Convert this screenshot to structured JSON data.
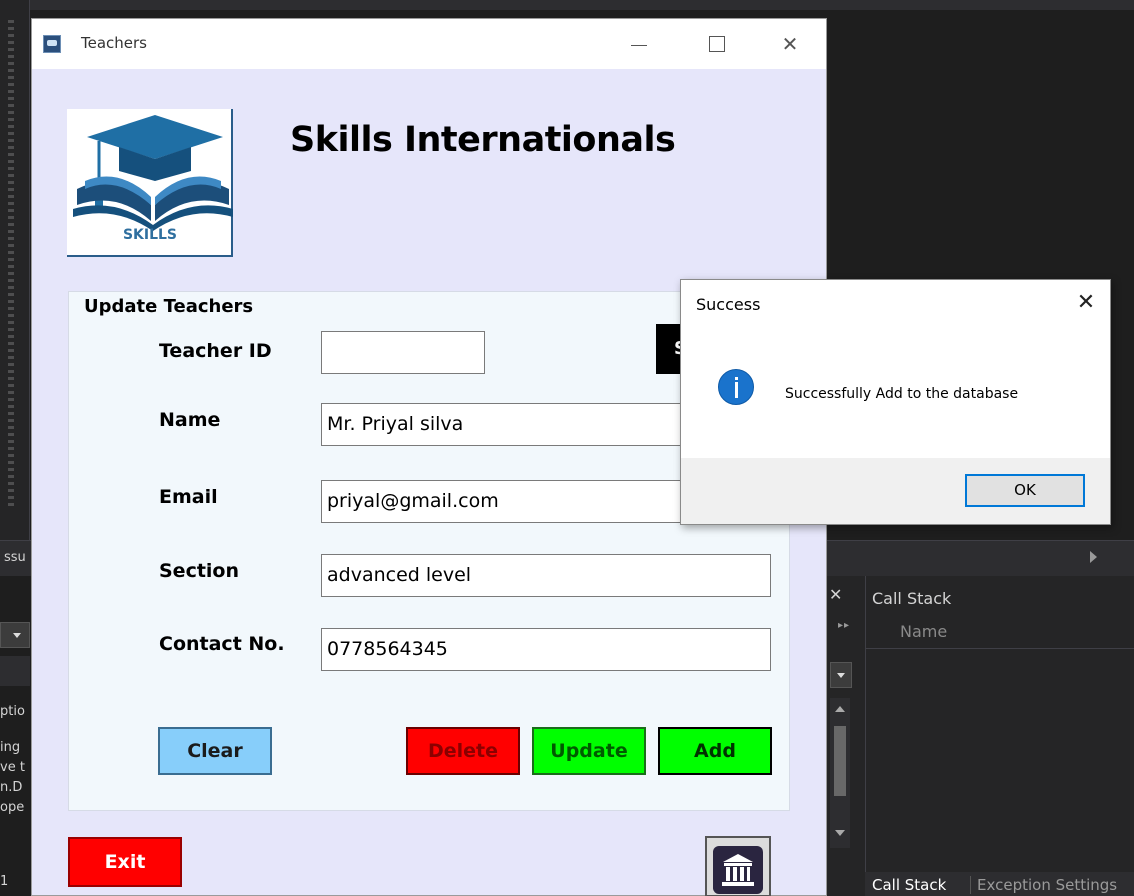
{
  "window": {
    "title": "Teachers",
    "close_glyph": "✕"
  },
  "logo": {
    "text": "SKILLS"
  },
  "app_title": "Skills Internationals",
  "group": {
    "legend": "Update Teachers",
    "search_label": "S",
    "fields": {
      "teacher_id": {
        "label": "Teacher ID",
        "value": ""
      },
      "name": {
        "label": "Name",
        "value": "Mr. Priyal silva"
      },
      "email": {
        "label": "Email",
        "value": "priyal@gmail.com"
      },
      "section": {
        "label": "Section",
        "value": "advanced level"
      },
      "contact": {
        "label": "Contact No.",
        "value": "0778564345"
      }
    }
  },
  "buttons": {
    "clear": "Clear",
    "delete": "Delete",
    "update": "Update",
    "add": "Add",
    "exit": "Exit"
  },
  "icons": {
    "home": "institution-icon",
    "info": "info-icon"
  },
  "dialog": {
    "title": "Success",
    "close_glyph": "✕",
    "message": "Successfully Add to the database",
    "ok": "OK"
  },
  "ide": {
    "tab_fragment": "ssu",
    "left_fragments": [
      "ptio",
      "ing",
      "ve t",
      "n.D",
      "ope",
      "1"
    ],
    "callstack_title": "Call Stack",
    "callstack_column": "Name",
    "bottom_tabs": [
      "Call Stack",
      "Exception Settings"
    ],
    "close_glyph": "✕"
  },
  "colors": {
    "form_bg": "#e6e6fa",
    "clear": "#87cefa",
    "delete": "#ff0000",
    "update": "#00ff00",
    "add": "#00ff00",
    "exit": "#ff0000",
    "accent": "#0078d7"
  }
}
